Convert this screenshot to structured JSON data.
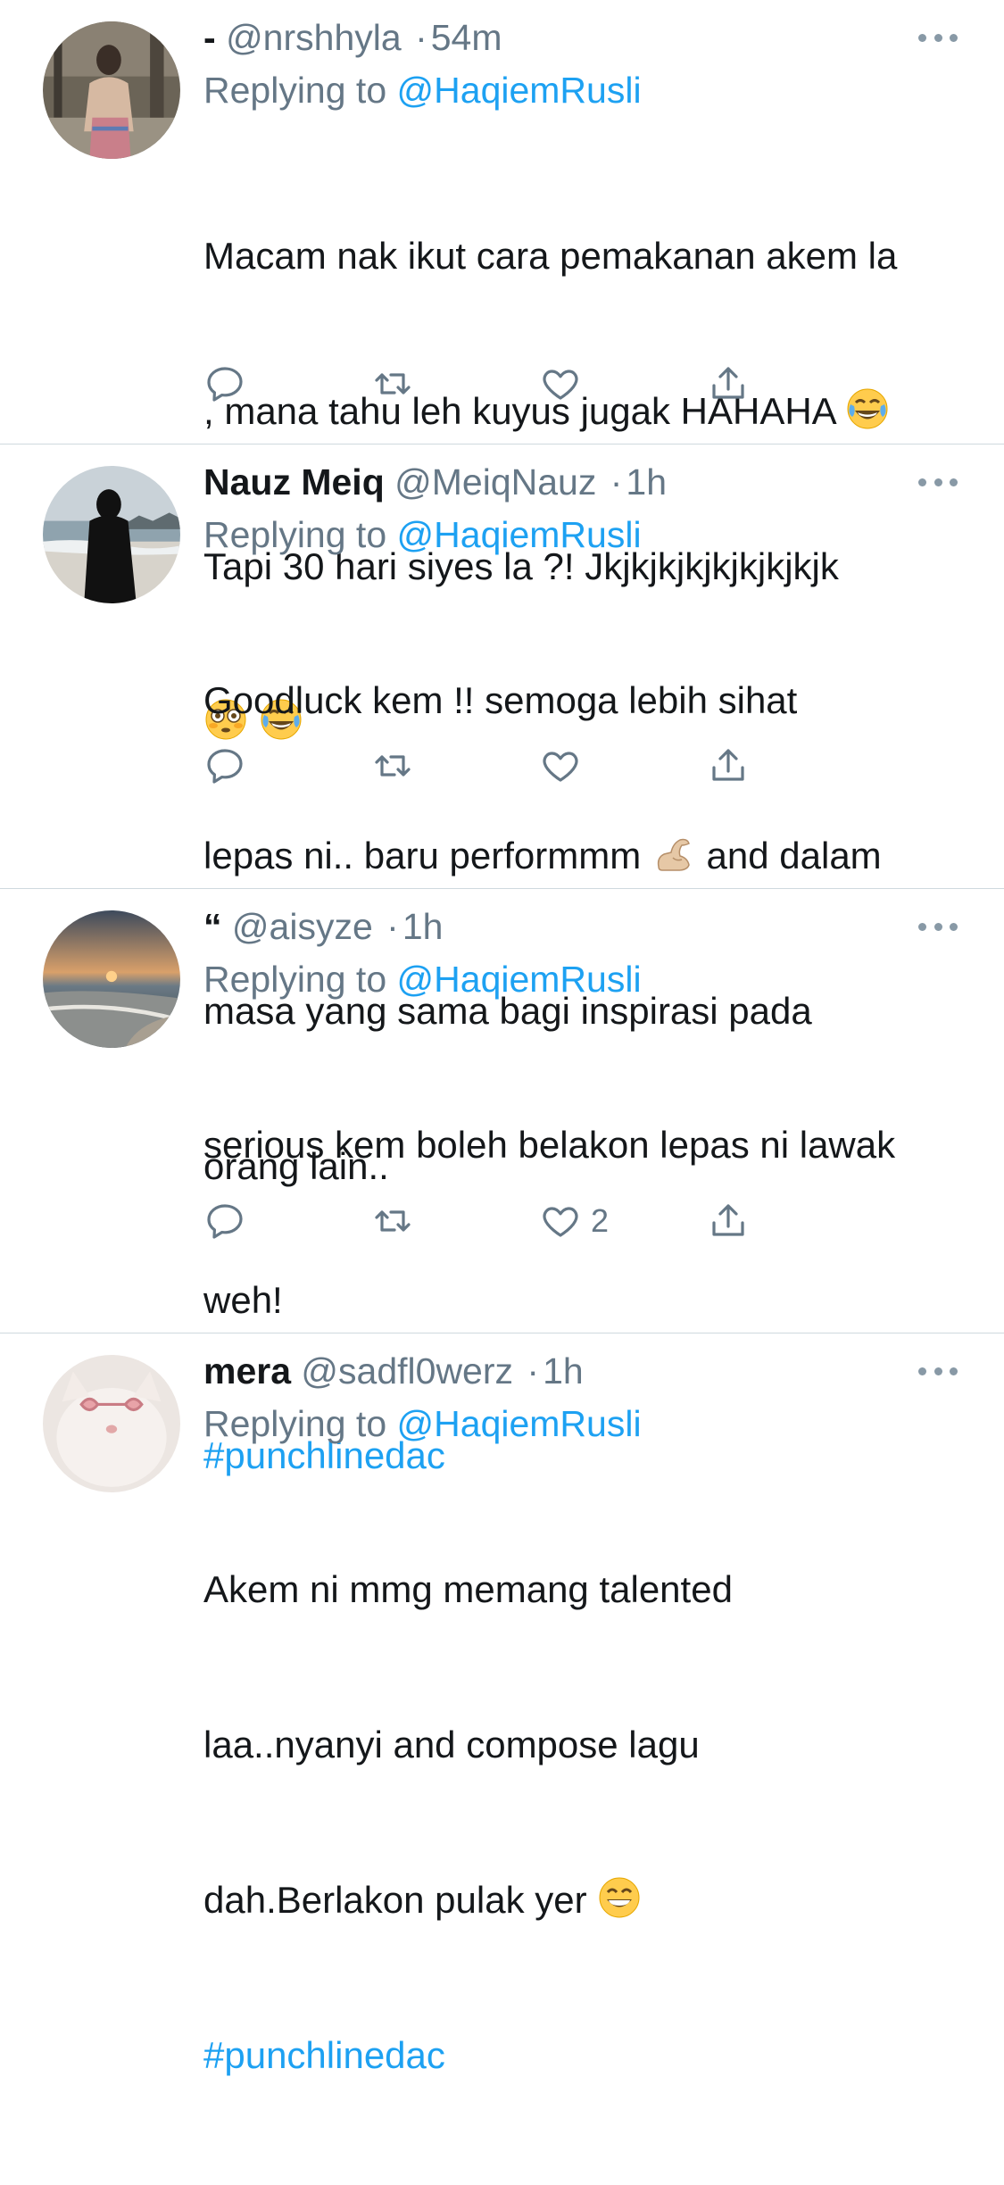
{
  "tweets": [
    {
      "display_name": "-",
      "handle": "@nrshhyla",
      "separator": "·",
      "time": "54m",
      "replying_prefix": "Replying to",
      "replying_to": "@HaqiemRusli",
      "text_lines": [
        "Macam nak ikut cara pemakanan akem la",
        ", mana tahu leh kuyus jugak HAHAHA",
        "Tapi 30 hari siyes la ?! Jkjkjkjkjkjkjkjkjk"
      ],
      "emojis": [
        "face-with-tears-of-joy",
        "flushed-face",
        "face-with-tears-of-joy"
      ],
      "hashtag": "",
      "like_count": ""
    },
    {
      "display_name": "Nauz Meiq",
      "handle": "@MeiqNauz",
      "separator": "·",
      "time": "1h",
      "replying_prefix": "Replying to",
      "replying_to": "@HaqiemRusli",
      "text_lines": [
        "Goodluck kem !! semoga lebih sihat",
        "lepas ni.. baru performmm",
        "and dalam",
        "masa yang sama bagi inspirasi pada",
        "orang lain.."
      ],
      "emojis": [
        "flexed-biceps"
      ],
      "hashtag": "",
      "like_count": ""
    },
    {
      "display_name": "“",
      "handle": "@aisyze",
      "separator": "·",
      "time": "1h",
      "replying_prefix": "Replying to",
      "replying_to": "@HaqiemRusli",
      "text_lines": [
        "serious kem boleh belakon lepas ni lawak",
        "weh!"
      ],
      "emojis": [],
      "hashtag": "#punchlinedac",
      "like_count": "2"
    },
    {
      "display_name": "mera",
      "handle": "@sadfl0werz",
      "separator": "·",
      "time": "1h",
      "replying_prefix": "Replying to",
      "replying_to": "@HaqiemRusli",
      "text_lines": [
        "Akem ni mmg memang talented",
        "laa..nyanyi and compose lagu",
        "dah.Berlakon pulak yer"
      ],
      "emojis": [
        "grinning-face-with-smiling-eyes"
      ],
      "hashtag": "#punchlinedac",
      "like_count": ""
    }
  ],
  "icons": {
    "reply": "reply-icon",
    "retweet": "retweet-icon",
    "like": "heart-icon",
    "share": "share-icon",
    "more": "more-dots-icon"
  },
  "colors": {
    "text": "#14171a",
    "secondary": "#657786",
    "link": "#1da1f2",
    "divider": "#cfd9de"
  }
}
